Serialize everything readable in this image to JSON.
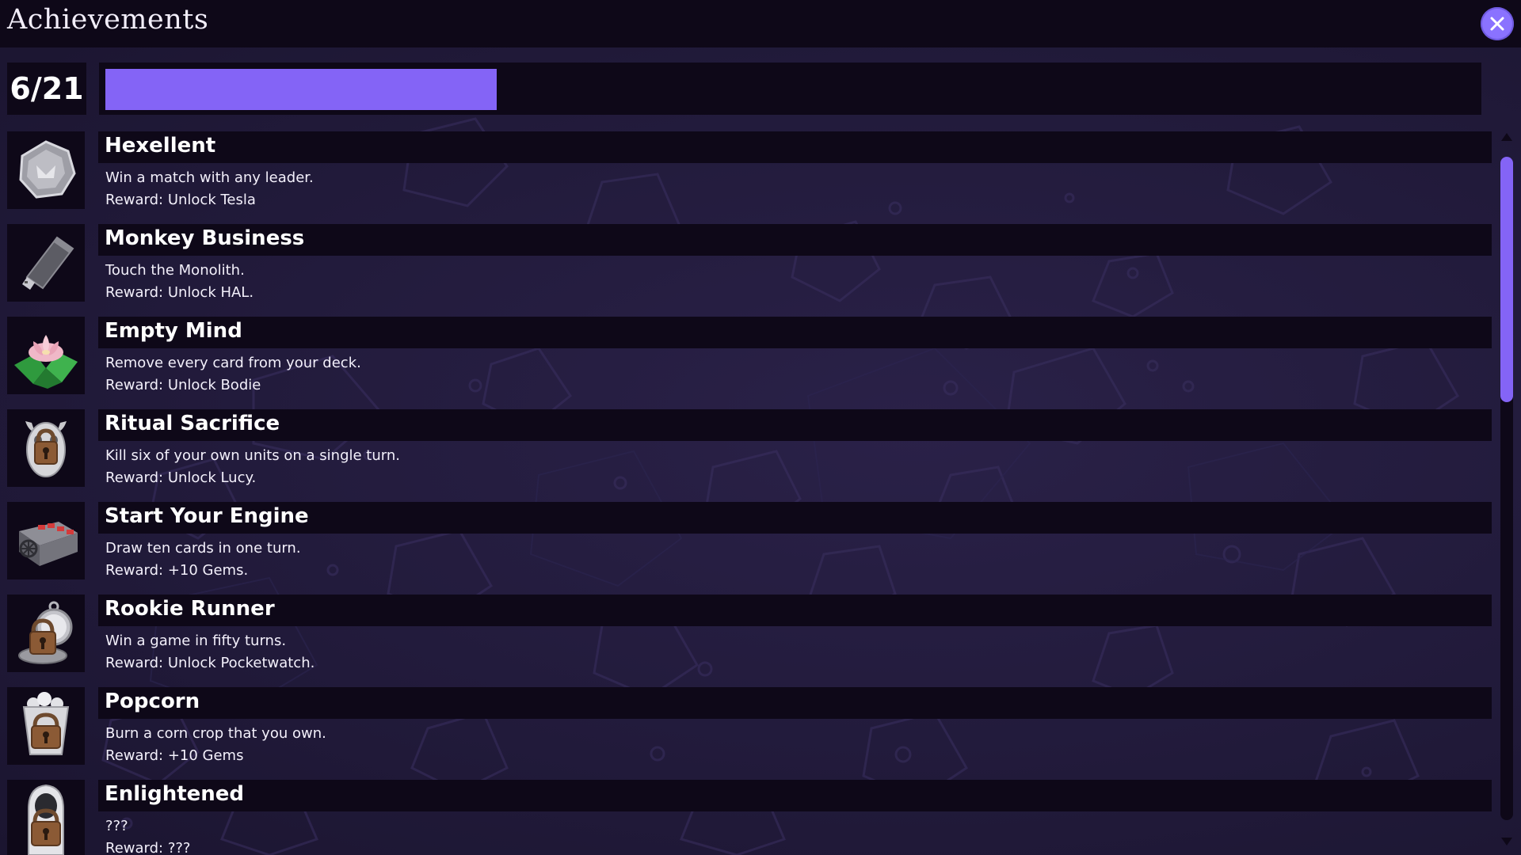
{
  "window": {
    "title": "Achievements",
    "close_icon": "close-x-icon",
    "accent_color": "#8464f6"
  },
  "progress": {
    "label": "6/21",
    "unlocked": 6,
    "total": 21
  },
  "achievements": [
    {
      "name": "Hexellent",
      "description": "Win a match with any leader.",
      "reward": "Reward: Unlock Tesla",
      "icon": "silver-hexagon-medal-icon",
      "locked": false
    },
    {
      "name": "Monkey Business",
      "description": "Touch the Monolith.",
      "reward": "Reward: Unlock HAL.",
      "icon": "usb-drive-icon",
      "locked": false
    },
    {
      "name": "Empty Mind",
      "description": "Remove every card from your deck.",
      "reward": "Reward: Unlock Bodie",
      "icon": "lotus-flower-icon",
      "locked": false
    },
    {
      "name": "Ritual Sacrifice",
      "description": "Kill six of your own units on a single turn.",
      "reward": "Reward: Unlock Lucy.",
      "icon": "cow-skull-padlock-icon",
      "locked": true
    },
    {
      "name": "Start Your Engine",
      "description": "Draw ten cards in one turn.",
      "reward": "Reward: +10 Gems.",
      "icon": "engine-block-icon",
      "locked": false
    },
    {
      "name": "Rookie Runner",
      "description": "Win a game in fifty turns.",
      "reward": "Reward: Unlock Pocketwatch.",
      "icon": "pocketwatch-padlock-icon",
      "locked": true
    },
    {
      "name": "Popcorn",
      "description": "Burn a corn crop that you own.",
      "reward": "Reward: +10 Gems",
      "icon": "popcorn-bag-padlock-icon",
      "locked": true
    },
    {
      "name": "Enlightened",
      "description": "???",
      "reward": "Reward: ???",
      "icon": "hooded-figure-padlock-icon",
      "locked": true
    }
  ],
  "scrollbar": {
    "up_icon": "scroll-up-arrow-icon",
    "down_icon": "scroll-down-arrow-icon"
  }
}
